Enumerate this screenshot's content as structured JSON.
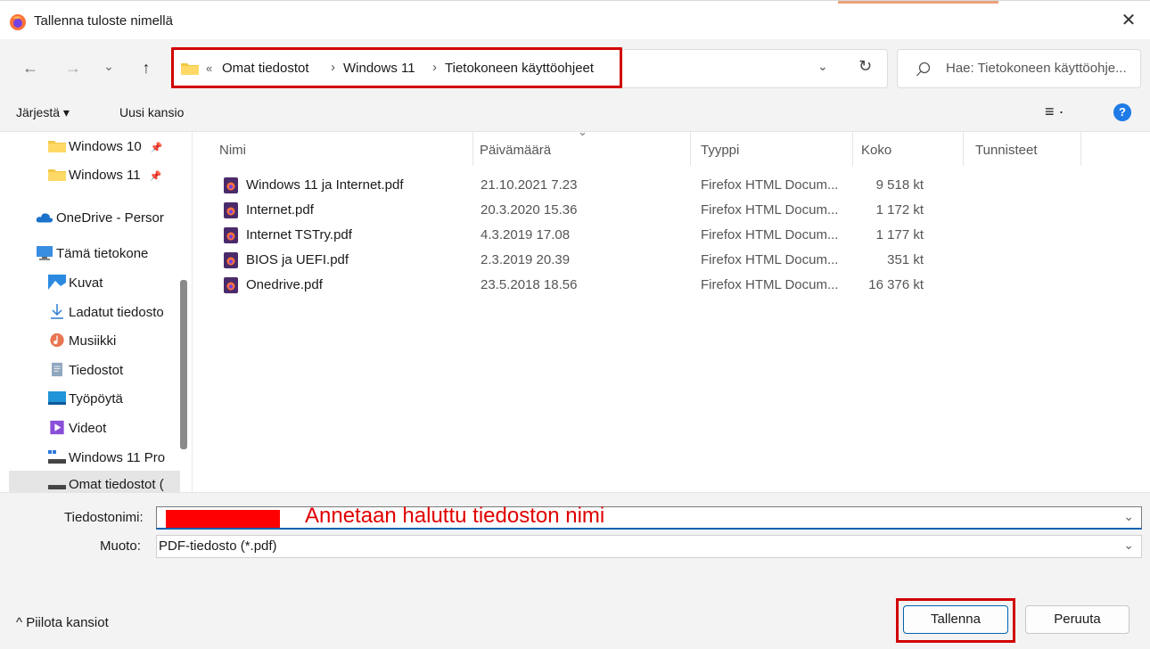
{
  "window": {
    "title": "Tallenna tuloste nimellä",
    "close_glyph": "✕"
  },
  "nav": {
    "back_glyph": "←",
    "forward_glyph": "→",
    "recent_glyph": "⌄",
    "up_glyph": "↑",
    "overflow_glyph": "«",
    "breadcrumbs": [
      "Omat tiedostot",
      "Windows 11",
      "Tietokoneen käyttöohjeet"
    ],
    "separator": "›",
    "dropdown_glyph": "⌄",
    "refresh_glyph": "↻",
    "search_placeholder": "Hae: Tietokoneen käyttöohje..."
  },
  "toolbar": {
    "organize_label": "Järjestä ▾",
    "new_folder_label": "Uusi kansio",
    "view_glyph": "≡ ·",
    "help_glyph": "?"
  },
  "sidebar": {
    "items": [
      {
        "label": "Windows 10",
        "icon": "folder-icon",
        "pin": "📌"
      },
      {
        "label": "Windows 11",
        "icon": "folder-icon",
        "pin": "📌"
      },
      {
        "label": "OneDrive - Persor",
        "icon": "onedrive-icon"
      },
      {
        "label": "Tämä tietokone",
        "icon": "computer-icon"
      },
      {
        "label": "Kuvat",
        "icon": "pictures-icon"
      },
      {
        "label": "Ladatut tiedosto",
        "icon": "downloads-icon"
      },
      {
        "label": "Musiikki",
        "icon": "music-icon"
      },
      {
        "label": "Tiedostot",
        "icon": "documents-icon"
      },
      {
        "label": "Työpöytä",
        "icon": "desktop-icon"
      },
      {
        "label": "Videot",
        "icon": "videos-icon"
      },
      {
        "label": "Windows 11 Pro",
        "icon": "drive-icon"
      },
      {
        "label": "Omat tiedostot (",
        "icon": "drive-icon"
      }
    ]
  },
  "columns": {
    "name": "Nimi",
    "date": "Päivämäärä",
    "type": "Tyyppi",
    "size": "Koko",
    "tags": "Tunnisteet",
    "sort_glyph": "⌄"
  },
  "files": [
    {
      "name": "Windows 11 ja Internet.pdf",
      "date": "21.10.2021 7.23",
      "type": "Firefox HTML Docum...",
      "size": "9 518 kt"
    },
    {
      "name": "Internet.pdf",
      "date": "20.3.2020 15.36",
      "type": "Firefox HTML Docum...",
      "size": "1 172 kt"
    },
    {
      "name": "Internet TSTry.pdf",
      "date": "4.3.2019 17.08",
      "type": "Firefox HTML Docum...",
      "size": "1 177 kt"
    },
    {
      "name": "BIOS ja UEFI.pdf",
      "date": "2.3.2019 20.39",
      "type": "Firefox HTML Docum...",
      "size": "351 kt"
    },
    {
      "name": "Onedrive.pdf",
      "date": "23.5.2018 18.56",
      "type": "Firefox HTML Docum...",
      "size": "16 376 kt"
    }
  ],
  "form": {
    "filename_label": "Tiedostonimi:",
    "filename_annotation": "Annetaan haluttu tiedoston nimi",
    "format_label": "Muoto:",
    "format_value": "PDF-tiedosto (*.pdf)",
    "dropdown_glyph": "⌄",
    "hide_folders_label": "^ Piilota kansiot",
    "save_label": "Tallenna",
    "cancel_label": "Peruuta"
  },
  "colors": {
    "highlight_red": "#d10000",
    "accent_blue": "#0063b1"
  }
}
